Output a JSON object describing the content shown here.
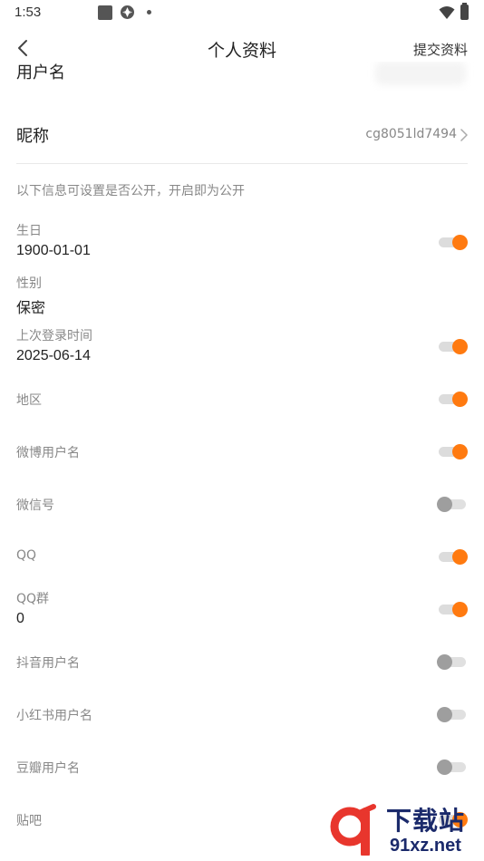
{
  "status_bar": {
    "time": "1:53"
  },
  "header": {
    "title": "个人资料",
    "submit_label": "提交资料",
    "back_icon": "chevron-left-icon"
  },
  "profile": {
    "username_label": "用户名",
    "nickname_label": "昵称",
    "nickname_value": "cg8051ld7494"
  },
  "privacy_note": "以下信息可设置是否公开，开启即为公开",
  "settings": [
    {
      "label": "生日",
      "value": "1900-01-01",
      "public": true
    },
    {
      "label": "性别",
      "value": "保密",
      "public": null
    },
    {
      "label": "上次登录时间",
      "value": "2025-06-14",
      "public": true
    },
    {
      "label": "地区",
      "value": "",
      "public": true
    },
    {
      "label": "微博用户名",
      "value": "",
      "public": true
    },
    {
      "label": "微信号",
      "value": "",
      "public": false
    },
    {
      "label": "QQ",
      "value": "",
      "public": true
    },
    {
      "label": "QQ群",
      "value": "0",
      "public": true
    },
    {
      "label": "抖音用户名",
      "value": "",
      "public": false
    },
    {
      "label": "小红书用户名",
      "value": "",
      "public": false
    },
    {
      "label": "豆瓣用户名",
      "value": "",
      "public": false
    },
    {
      "label": "贴吧",
      "value": "",
      "public": true
    }
  ],
  "colors": {
    "accent": "#ff7a10",
    "toggle_off": "#9e9e9e"
  },
  "watermark": {
    "title": "下载站",
    "url": "91xz.net"
  }
}
